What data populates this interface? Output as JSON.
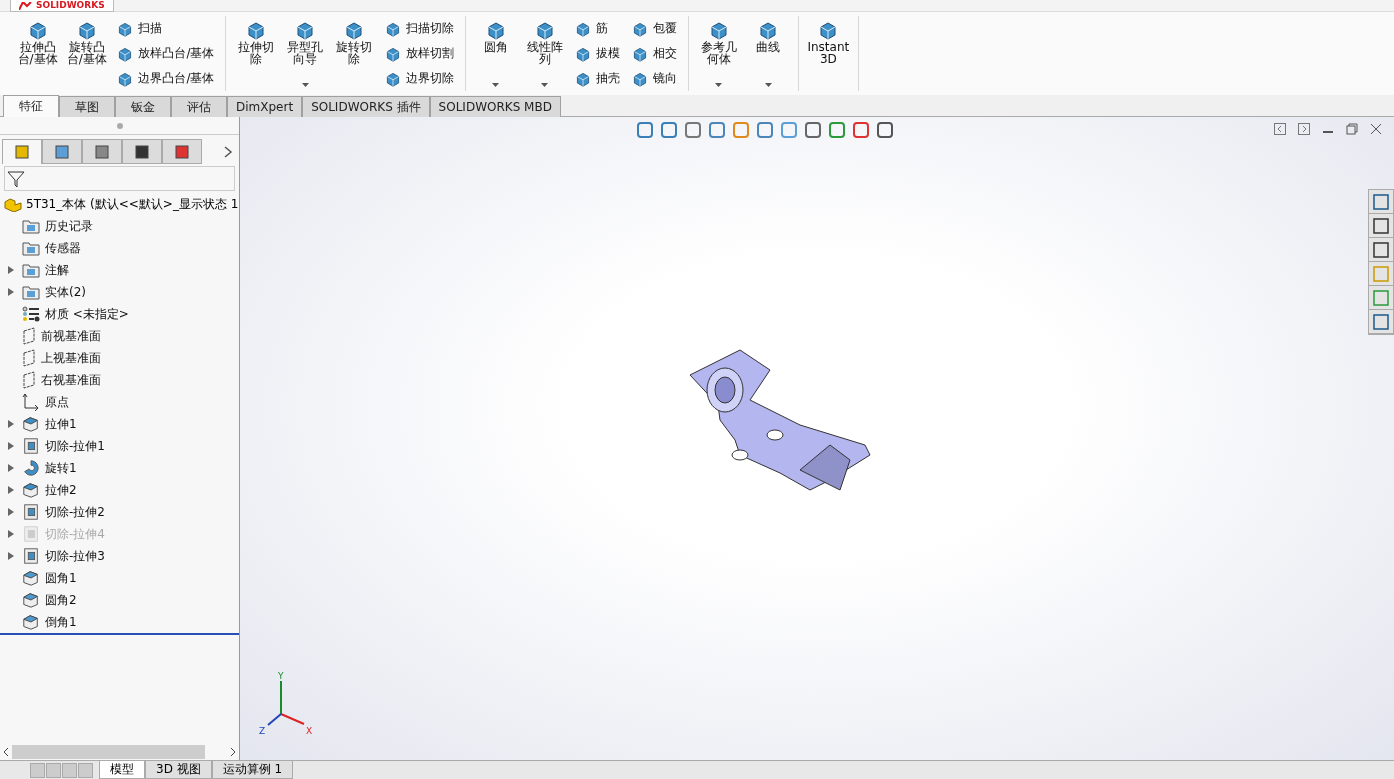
{
  "app": {
    "logo": "SOLIDWORKS"
  },
  "ribbon": {
    "groups": [
      {
        "items": [
          {
            "kind": "large",
            "label": "拉伸凸台/基体",
            "dropdown": false
          },
          {
            "kind": "large",
            "label": "旋转凸台/基体",
            "dropdown": false
          },
          {
            "kind": "stack",
            "items": [
              {
                "label": "扫描"
              },
              {
                "label": "放样凸台/基体"
              },
              {
                "label": "边界凸台/基体"
              }
            ]
          }
        ]
      },
      {
        "items": [
          {
            "kind": "large",
            "label": "拉伸切除",
            "dropdown": false
          },
          {
            "kind": "large",
            "label": "异型孔向导",
            "dropdown": true
          },
          {
            "kind": "large",
            "label": "旋转切除",
            "dropdown": false
          },
          {
            "kind": "stack",
            "items": [
              {
                "label": "扫描切除"
              },
              {
                "label": "放样切割"
              },
              {
                "label": "边界切除"
              }
            ]
          }
        ]
      },
      {
        "items": [
          {
            "kind": "large",
            "label": "圆角",
            "dropdown": true
          },
          {
            "kind": "large",
            "label": "线性阵列",
            "dropdown": true
          },
          {
            "kind": "stack",
            "items": [
              {
                "label": "筋"
              },
              {
                "label": "拔模"
              },
              {
                "label": "抽壳"
              }
            ]
          },
          {
            "kind": "stack",
            "items": [
              {
                "label": "包覆"
              },
              {
                "label": "相交"
              },
              {
                "label": "镜向"
              }
            ]
          }
        ]
      },
      {
        "items": [
          {
            "kind": "large",
            "label": "参考几何体",
            "dropdown": true
          },
          {
            "kind": "large",
            "label": "曲线",
            "dropdown": true
          }
        ]
      },
      {
        "items": [
          {
            "kind": "large",
            "label": "Instant3D",
            "dropdown": false
          }
        ]
      }
    ]
  },
  "tabs": [
    {
      "label": "特征",
      "selected": true
    },
    {
      "label": "草图",
      "selected": false
    },
    {
      "label": "钣金",
      "selected": false
    },
    {
      "label": "评估",
      "selected": false
    },
    {
      "label": "DimXpert",
      "selected": false
    },
    {
      "label": "SOLIDWORKS 插件",
      "selected": false
    },
    {
      "label": "SOLIDWORKS MBD",
      "selected": false
    }
  ],
  "panel_tabs": [
    {
      "selected": true
    },
    {
      "selected": false
    },
    {
      "selected": false
    },
    {
      "selected": false
    },
    {
      "selected": false
    }
  ],
  "tree": {
    "root": "5T31_本体  (默认<<默认>_显示状态 1",
    "items": [
      {
        "kind": "folder",
        "label": "历史记录",
        "expandable": false,
        "disabled": false
      },
      {
        "kind": "folder",
        "label": "传感器",
        "expandable": false,
        "disabled": false
      },
      {
        "kind": "folder",
        "label": "注解",
        "expandable": true,
        "disabled": false
      },
      {
        "kind": "folder",
        "label": "实体(2)",
        "expandable": true,
        "disabled": false
      },
      {
        "kind": "material",
        "label": "材质 <未指定>",
        "expandable": false,
        "disabled": false
      },
      {
        "kind": "plane",
        "label": "前视基准面",
        "expandable": false,
        "disabled": false
      },
      {
        "kind": "plane",
        "label": "上视基准面",
        "expandable": false,
        "disabled": false
      },
      {
        "kind": "plane",
        "label": "右视基准面",
        "expandable": false,
        "disabled": false
      },
      {
        "kind": "origin",
        "label": "原点",
        "expandable": false,
        "disabled": false
      },
      {
        "kind": "extrude",
        "label": "拉伸1",
        "expandable": true,
        "disabled": false
      },
      {
        "kind": "cut",
        "label": "切除-拉伸1",
        "expandable": true,
        "disabled": false
      },
      {
        "kind": "revolve",
        "label": "旋转1",
        "expandable": true,
        "disabled": false
      },
      {
        "kind": "extrude",
        "label": "拉伸2",
        "expandable": true,
        "disabled": false
      },
      {
        "kind": "cut",
        "label": "切除-拉伸2",
        "expandable": true,
        "disabled": false
      },
      {
        "kind": "cut",
        "label": "切除-拉伸4",
        "expandable": true,
        "disabled": true
      },
      {
        "kind": "cut",
        "label": "切除-拉伸3",
        "expandable": true,
        "disabled": false
      },
      {
        "kind": "fillet",
        "label": "圆角1",
        "expandable": false,
        "disabled": false
      },
      {
        "kind": "fillet",
        "label": "圆角2",
        "expandable": false,
        "disabled": false
      },
      {
        "kind": "chamfer",
        "label": "倒角1",
        "expandable": false,
        "disabled": false
      }
    ]
  },
  "triad": {
    "x": "X",
    "y": "Y",
    "z": "Z"
  },
  "bottom_tabs": [
    {
      "label": "模型",
      "selected": true
    },
    {
      "label": "3D 视图",
      "selected": false
    },
    {
      "label": "运动算例 1",
      "selected": false
    }
  ]
}
